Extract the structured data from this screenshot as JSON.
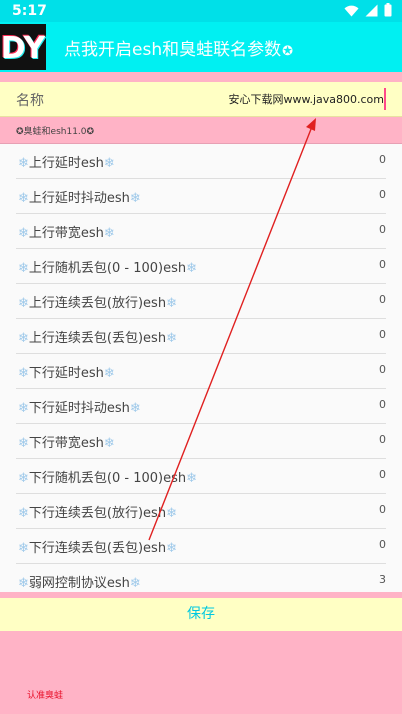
{
  "status_bar": {
    "time": "5:17"
  },
  "app_bar": {
    "title": "点我开启esh和臭蛙联名参数",
    "title_icon": "✪",
    "logo_text": "DY"
  },
  "name_row": {
    "label": "名称",
    "value": "安心下载网www.java800.com"
  },
  "section": {
    "title": "✪臭蛙和esh11.0✪"
  },
  "settings": {
    "icon": "❄",
    "items": [
      {
        "label": "上行延时esh",
        "value": "0"
      },
      {
        "label": "上行延时抖动esh",
        "value": "0"
      },
      {
        "label": "上行带宽esh",
        "value": "0"
      },
      {
        "label": "上行随机丢包(0 - 100)esh",
        "value": "0"
      },
      {
        "label": "上行连续丢包(放行)esh",
        "value": "0"
      },
      {
        "label": "上行连续丢包(丢包)esh",
        "value": "0"
      },
      {
        "label": "下行延时esh",
        "value": "0"
      },
      {
        "label": "下行延时抖动esh",
        "value": "0"
      },
      {
        "label": "下行带宽esh",
        "value": "0"
      },
      {
        "label": "下行随机丢包(0 - 100)esh",
        "value": "0"
      },
      {
        "label": "下行连续丢包(放行)esh",
        "value": "0"
      },
      {
        "label": "下行连续丢包(丢包)esh",
        "value": "0"
      },
      {
        "label": "弱网控制协议esh",
        "value": "3"
      }
    ]
  },
  "save_button": {
    "label": "保存"
  },
  "footer": {
    "text": "认准臭蛙"
  },
  "icons": {
    "status": [
      "wifi-icon",
      "signal-icon",
      "battery-icon"
    ],
    "title": "star-circle-icon",
    "item": "snowflake-icon"
  },
  "colors": {
    "app_bar": "#00f0f2",
    "status_bar": "#00e0e8",
    "background": "#ffb3c6",
    "name_row": "#ffffc4",
    "list": "#fafafa",
    "save_text": "#00c8e0",
    "footer_text": "#e8102a",
    "annotation_arrow": "#e02020"
  }
}
